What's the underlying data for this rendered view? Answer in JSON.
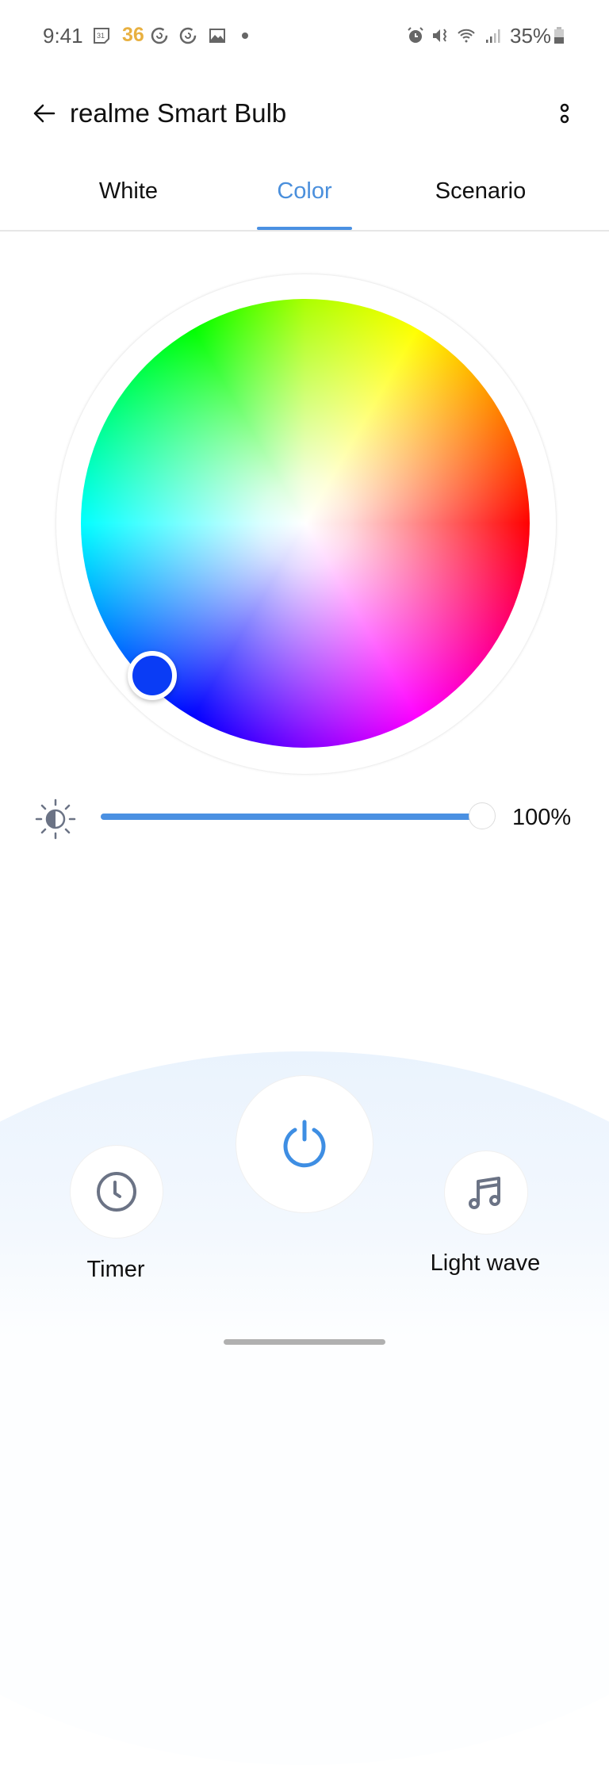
{
  "status_bar": {
    "time": "9:41",
    "calendar_day": "31",
    "notification_count": "36",
    "battery_percent": "35%",
    "icons": [
      "calendar-icon",
      "sync-icon",
      "sync-icon",
      "gallery-icon",
      "dot-icon",
      "alarm-icon",
      "mute-vibrate-icon",
      "wifi-icon",
      "signal-icon",
      "battery-icon"
    ]
  },
  "header": {
    "title": "realme Smart Bulb",
    "back_icon": "arrow-left-icon",
    "menu_icon": "more-vertical-icon"
  },
  "tabs": [
    {
      "label": "White",
      "active": false
    },
    {
      "label": "Color",
      "active": true
    },
    {
      "label": "Scenario",
      "active": false
    }
  ],
  "color_picker": {
    "selected_color": "#0a3cf5",
    "accent": "#4a90e2"
  },
  "brightness": {
    "icon": "brightness-icon",
    "value_percent": 100,
    "label": "100%"
  },
  "bottom_actions": {
    "timer_label": "Timer",
    "power_icon": "power-icon",
    "light_wave_label": "Light wave"
  }
}
